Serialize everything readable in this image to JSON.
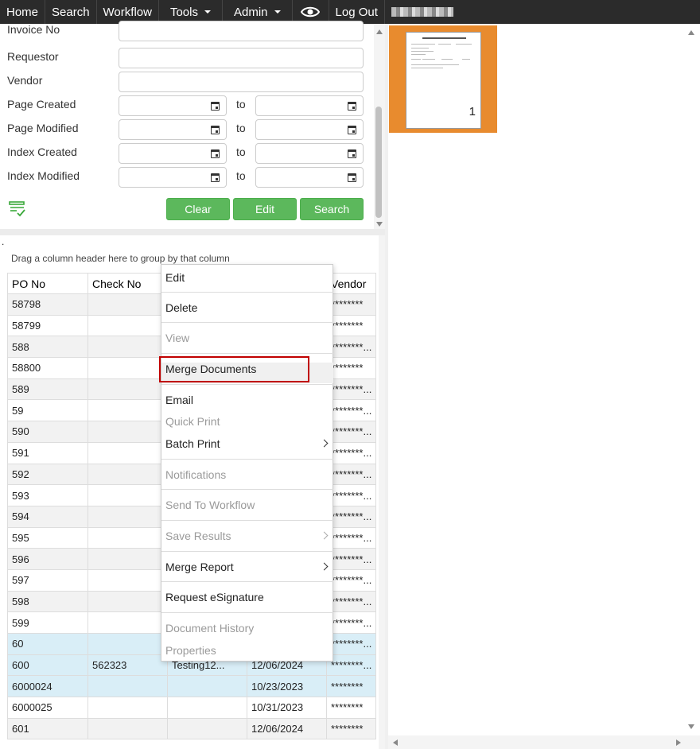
{
  "nav": {
    "home": "Home",
    "search": "Search",
    "workflow": "Workflow",
    "tools": "Tools",
    "admin": "Admin",
    "logout": "Log Out"
  },
  "form": {
    "invoice_no": "Invoice No",
    "requestor": "Requestor",
    "vendor": "Vendor",
    "page_created": "Page Created",
    "page_modified": "Page Modified",
    "index_created": "Index Created",
    "index_modified": "Index Modified",
    "to": "to",
    "clear": "Clear",
    "edit": "Edit",
    "search": "Search"
  },
  "grid": {
    "dot": ".",
    "group_hint": "Drag a column header here to group by that column",
    "headers": [
      "PO No",
      "Check No",
      "",
      "",
      "Vendor"
    ],
    "rows": [
      {
        "po": "58798",
        "check": "",
        "c3": "",
        "c4": "",
        "vendor": "********"
      },
      {
        "po": "58799",
        "check": "",
        "c3": "",
        "c4": "",
        "vendor": "********"
      },
      {
        "po": "588",
        "check": "",
        "c3": "",
        "c4": "",
        "vendor": "********..."
      },
      {
        "po": "58800",
        "check": "",
        "c3": "",
        "c4": "",
        "vendor": "********"
      },
      {
        "po": "589",
        "check": "",
        "c3": "",
        "c4": "",
        "vendor": "********..."
      },
      {
        "po": "59",
        "check": "",
        "c3": "",
        "c4": "",
        "vendor": "********..."
      },
      {
        "po": "590",
        "check": "",
        "c3": "",
        "c4": "",
        "vendor": "********..."
      },
      {
        "po": "591",
        "check": "",
        "c3": "",
        "c4": "",
        "vendor": "********..."
      },
      {
        "po": "592",
        "check": "",
        "c3": "",
        "c4": "",
        "vendor": "********..."
      },
      {
        "po": "593",
        "check": "",
        "c3": "",
        "c4": "",
        "vendor": "********..."
      },
      {
        "po": "594",
        "check": "",
        "c3": "",
        "c4": "",
        "vendor": "********..."
      },
      {
        "po": "595",
        "check": "",
        "c3": "",
        "c4": "",
        "vendor": "********..."
      },
      {
        "po": "596",
        "check": "",
        "c3": "",
        "c4": "",
        "vendor": "********..."
      },
      {
        "po": "597",
        "check": "",
        "c3": "",
        "c4": "",
        "vendor": "********..."
      },
      {
        "po": "598",
        "check": "",
        "c3": "",
        "c4": "",
        "vendor": "********..."
      },
      {
        "po": "599",
        "check": "",
        "c3": "",
        "c4": "",
        "vendor": "********..."
      },
      {
        "po": "60",
        "check": "",
        "c3": "",
        "c4": "",
        "vendor": "********..."
      },
      {
        "po": "600",
        "check": "562323",
        "c3": "Testing12...",
        "c4": "12/06/2024",
        "vendor": "********..."
      },
      {
        "po": "6000024",
        "check": "",
        "c3": "",
        "c4": "10/23/2023",
        "vendor": "********"
      },
      {
        "po": "6000025",
        "check": "",
        "c3": "",
        "c4": "10/31/2023",
        "vendor": "********"
      },
      {
        "po": "601",
        "check": "",
        "c3": "",
        "c4": "12/06/2024",
        "vendor": "********"
      }
    ]
  },
  "menu": {
    "edit": "Edit",
    "delete": "Delete",
    "view": "View",
    "merge_documents": "Merge Documents",
    "email": "Email",
    "quick_print": "Quick Print",
    "batch_print": "Batch Print",
    "notifications": "Notifications",
    "send_to_workflow": "Send To Workflow",
    "save_results": "Save Results",
    "merge_report": "Merge Report",
    "request_esignature": "Request eSignature",
    "document_history": "Document History",
    "properties": "Properties"
  },
  "viewer": {
    "page_number": "1"
  },
  "colors": {
    "nav_bg": "#2b2b2b",
    "button_green": "#5cb85c",
    "thumb_orange": "#e88b2e",
    "highlight_red": "#c00000",
    "selected_row": "#d9eef7"
  }
}
